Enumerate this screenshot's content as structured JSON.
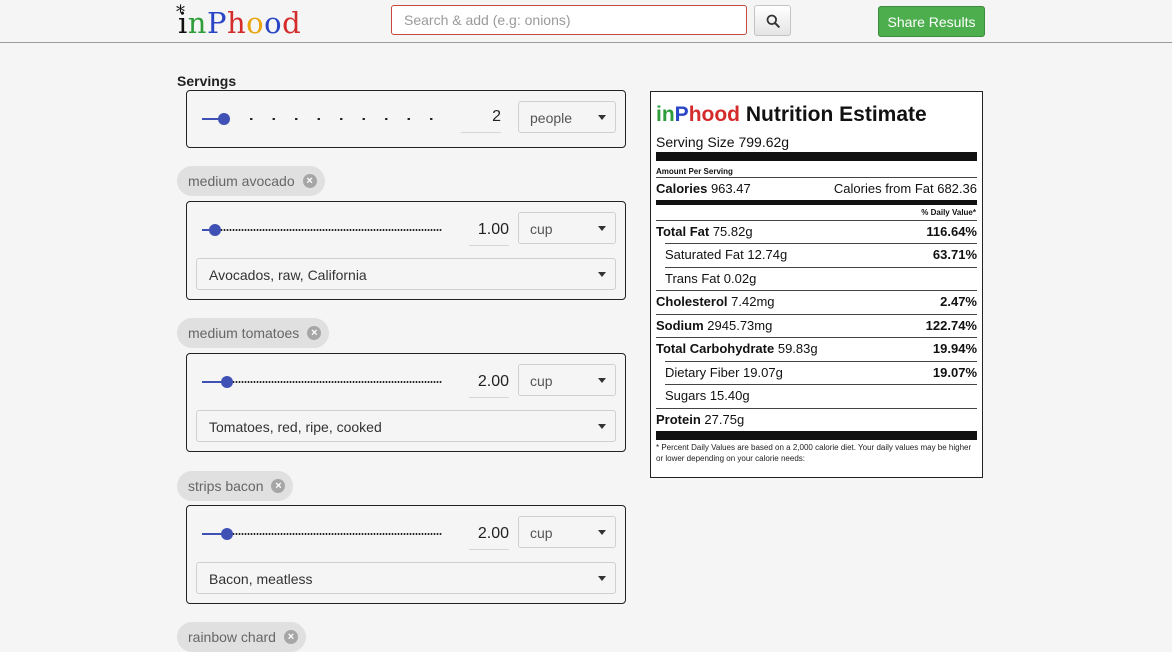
{
  "header": {
    "logo": {
      "star": "*",
      "i": "i",
      "n": "n",
      "P": "P",
      "h": "h",
      "o1": "o",
      "o2": "o",
      "d": "d"
    },
    "search_placeholder": "Search & add (e.g: onions)",
    "search_icon": "search-icon",
    "share_label": "Share Results"
  },
  "servings": {
    "label": "Servings",
    "value": "2",
    "unit": "people",
    "slider_fraction": 0.08
  },
  "ingredients": [
    {
      "chip": "medium avocado",
      "qty": "1.00",
      "unit": "cup",
      "food": "Avocados, raw, California",
      "slider_fraction": 0.05
    },
    {
      "chip": "medium tomatoes",
      "qty": "2.00",
      "unit": "cup",
      "food": "Tomatoes, red, ripe, cooked",
      "slider_fraction": 0.1
    },
    {
      "chip": "strips bacon",
      "qty": "2.00",
      "unit": "cup",
      "food": "Bacon, meatless",
      "slider_fraction": 0.1
    },
    {
      "chip": "rainbow chard"
    }
  ],
  "nutrition": {
    "brand_in": "in",
    "brand_P": "P",
    "brand_hood": "hood",
    "title_rest": " Nutrition Estimate",
    "serving_size": "Serving Size 799.62g",
    "amount_per_serving": "Amount Per Serving",
    "calories_label": "Calories",
    "calories_value": "963.47",
    "calories_from_fat": "Calories from Fat 682.36",
    "daily_value_header": "% Daily Value*",
    "rows": [
      {
        "label": "Total Fat",
        "value": "75.82g",
        "dv": "116.64%"
      },
      {
        "label": "Saturated Fat",
        "value": "12.74g",
        "dv": "63.71%"
      },
      {
        "label": "Trans Fat",
        "value": "0.02g",
        "dv": ""
      },
      {
        "label": "Cholesterol",
        "value": "7.42mg",
        "dv": "2.47%"
      },
      {
        "label": "Sodium",
        "value": "2945.73mg",
        "dv": "122.74%"
      },
      {
        "label": "Total Carbohydrate",
        "value": "59.83g",
        "dv": "19.94%"
      },
      {
        "label": "Dietary Fiber",
        "value": "19.07g",
        "dv": "19.07%"
      },
      {
        "label": "Sugars",
        "value": "15.40g",
        "dv": ""
      },
      {
        "label": "Protein",
        "value": "27.75g",
        "dv": ""
      }
    ],
    "footnote": "* Percent Daily Values are based on a 2,000 calorie diet. Your daily values may be higher or lower depending on your calorie needs:"
  },
  "colors": {
    "accent_green": "#4cae4c",
    "slider_blue": "#3f51b5",
    "search_border": "#c9453f"
  }
}
